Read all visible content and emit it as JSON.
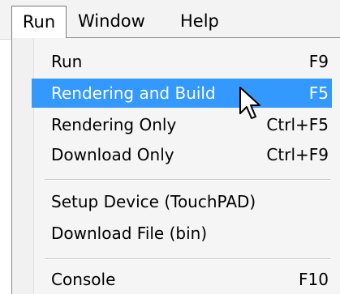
{
  "menubar": {
    "items": [
      "Run",
      "Window",
      "Help"
    ]
  },
  "menu": {
    "items": [
      {
        "label": "Run",
        "shortcut": "F9"
      },
      {
        "label": "Rendering and Build",
        "shortcut": "F5"
      },
      {
        "label": "Rendering Only",
        "shortcut": "Ctrl+F5"
      },
      {
        "label": "Download Only",
        "shortcut": "Ctrl+F9"
      },
      {
        "label": "Setup Device (TouchPAD)",
        "shortcut": ""
      },
      {
        "label": "Download File (bin)",
        "shortcut": ""
      },
      {
        "label": "Console",
        "shortcut": "F10"
      }
    ],
    "highlighted_index": 1
  },
  "colors": {
    "highlight": "#3399ff",
    "highlight_text": "#ffffff"
  },
  "cursor": {
    "icon": "arrow-pointer-icon"
  }
}
